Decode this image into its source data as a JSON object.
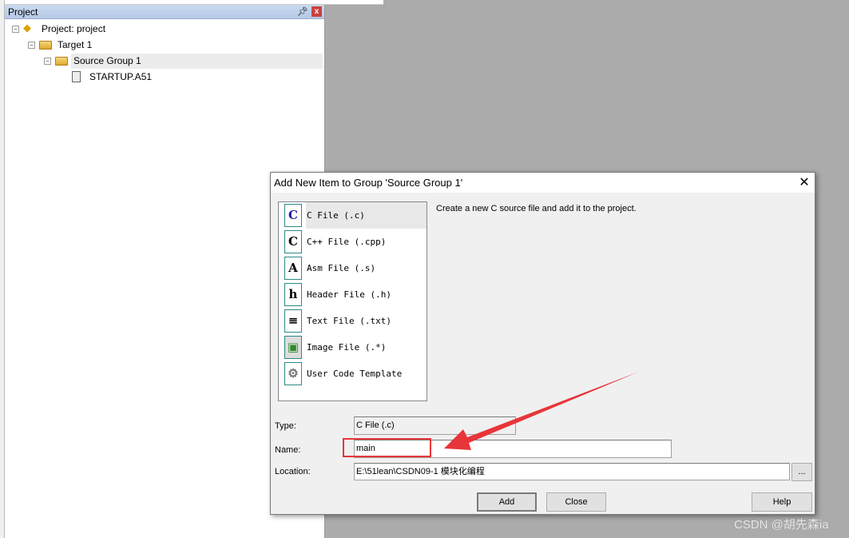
{
  "project_panel": {
    "title": "Project",
    "tree": [
      "Project: project",
      "Target 1",
      "Source Group 1",
      "STARTUP.A51"
    ]
  },
  "dialog": {
    "title": "Add New Item to Group 'Source Group 1'",
    "items": [
      {
        "label": "C File (.c)",
        "glyph": "C",
        "icon": "c-file-icon"
      },
      {
        "label": "C++ File (.cpp)",
        "glyph": "C",
        "icon": "cpp-file-icon"
      },
      {
        "label": "Asm File (.s)",
        "glyph": "A",
        "icon": "asm-file-icon"
      },
      {
        "label": "Header File (.h)",
        "glyph": "h",
        "icon": "header-file-icon"
      },
      {
        "label": "Text File (.txt)",
        "glyph": "≡",
        "icon": "text-file-icon"
      },
      {
        "label": "Image File (.*)",
        "glyph": "▣",
        "icon": "image-file-icon"
      },
      {
        "label": "User Code Template",
        "glyph": "⚙",
        "icon": "template-icon"
      }
    ],
    "selected": "C File (.c)",
    "description": "Create a new C source file and add it to the project.",
    "type_label": "Type:",
    "type_value": "C File (.c)",
    "name_label": "Name:",
    "name_value": "main",
    "location_label": "Location:",
    "location_value": "E:\\51lean\\CSDN09-1 模块化编程",
    "browse_label": "...",
    "add_label": "Add",
    "close_label": "Close",
    "help_label": "Help"
  },
  "annotation_color": "#e8353a",
  "watermark": "CSDN @胡先森ia"
}
